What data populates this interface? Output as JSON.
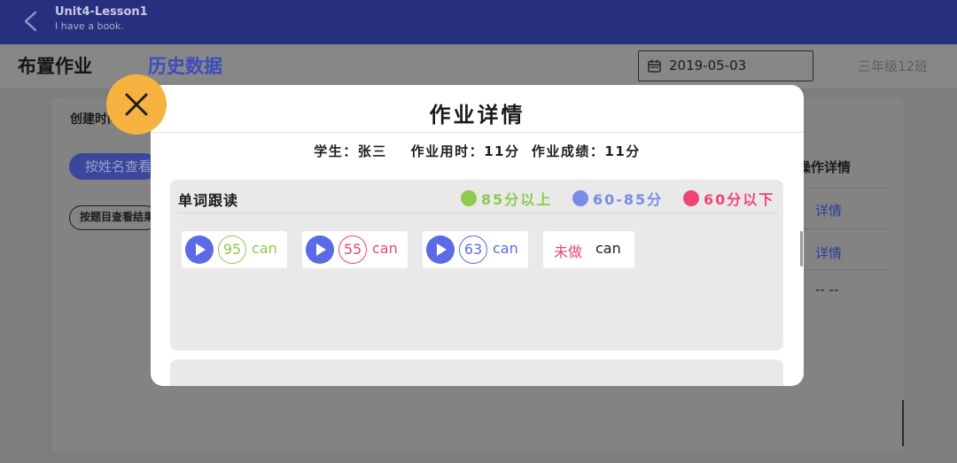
{
  "topbar": {
    "title": "Unit4-Lesson1",
    "subtitle": "I have a book."
  },
  "header": {
    "tab_assign": "布置作业",
    "tab_history": "历史数据",
    "date": "2019-05-03",
    "class_name": "三年级12班"
  },
  "background": {
    "create_label": "创建时间",
    "by_name_button": "按姓名查看",
    "by_question_button": "按题目查看结果",
    "ops_header": "操作详情",
    "detail_link_1": "详情",
    "detail_link_2": "详情",
    "dash_cell": "-- --"
  },
  "modal": {
    "title": "作业详情",
    "summary": "学生：张三    作业用时：11分  作业成绩：11分",
    "section_title": "单词跟读",
    "legend": [
      {
        "label": "85分以上",
        "color": "#8fc94e"
      },
      {
        "label": "60-85分",
        "color": "#7b8ae6"
      },
      {
        "label": "60分以下",
        "color": "#ef4575"
      }
    ],
    "words": [
      {
        "score": "95",
        "word": "can",
        "color": "#8fc94e"
      },
      {
        "score": "55",
        "word": "can",
        "color": "#ef4575"
      },
      {
        "score": "63",
        "word": "can",
        "color": "#5b6be6"
      }
    ],
    "undone": {
      "label": "未做",
      "word": "can"
    }
  },
  "icons": {
    "back": "chevron-left-icon",
    "calendar": "calendar-icon",
    "close": "close-icon",
    "play": "play-icon"
  },
  "colors": {
    "topbar": "#27307e",
    "accent": "#3d4cbf",
    "close_button": "#f6b33f"
  }
}
